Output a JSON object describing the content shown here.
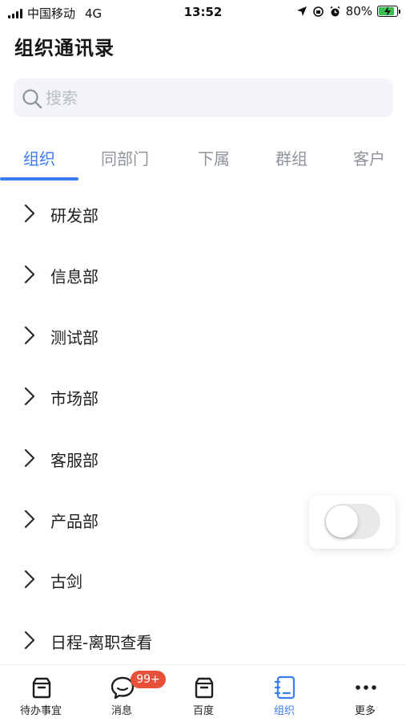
{
  "status_bar": {
    "carrier": "中国移动",
    "network": "4G",
    "time": "13:52",
    "battery": "80%"
  },
  "header": {
    "title": "组织通讯录"
  },
  "search": {
    "placeholder": "搜索"
  },
  "tabs": [
    {
      "label": "组织",
      "active": true
    },
    {
      "label": "同部门",
      "active": false
    },
    {
      "label": "下属",
      "active": false
    },
    {
      "label": "群组",
      "active": false
    },
    {
      "label": "客户",
      "active": false
    }
  ],
  "departments": [
    {
      "label": "研发部"
    },
    {
      "label": "信息部"
    },
    {
      "label": "测试部"
    },
    {
      "label": "市场部"
    },
    {
      "label": "客服部"
    },
    {
      "label": "产品部"
    },
    {
      "label": "古剑"
    },
    {
      "label": "日程-离职查看"
    }
  ],
  "floating_toggle": {
    "on": false
  },
  "tabbar": {
    "items": [
      {
        "label": "待办事宜",
        "icon": "inbox-icon"
      },
      {
        "label": "消息",
        "icon": "chat-bubble-icon",
        "badge": "99+"
      },
      {
        "label": "百度",
        "icon": "inbox-icon"
      },
      {
        "label": "组织",
        "icon": "contacts-book-icon",
        "active": true
      },
      {
        "label": "更多",
        "icon": "more-dots-icon"
      }
    ]
  },
  "colors": {
    "accent": "#3b7cf5",
    "badge": "#e8503a",
    "search_bg": "#f2f4f7",
    "battery": "#39c050"
  }
}
